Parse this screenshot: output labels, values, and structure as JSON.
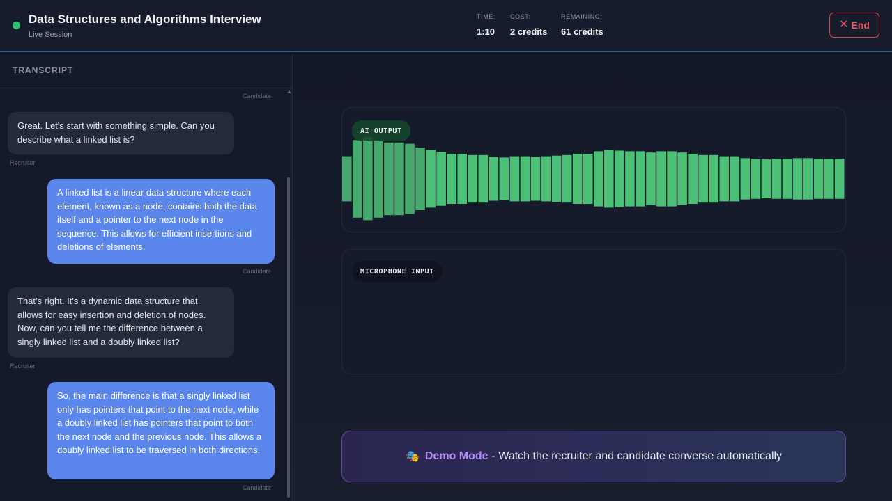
{
  "header": {
    "title": "Data Structures and Algorithms Interview",
    "subtitle": "Live Session",
    "stats": {
      "time_label": "TIME:",
      "time_value": "1:10",
      "cost_label": "COST:",
      "cost_value": "2 credits",
      "remaining_label": "REMAINING:",
      "remaining_value": "61 credits"
    },
    "end_icon": "✕",
    "end_label": "End",
    "live_color": "#2fbf71"
  },
  "transcript": {
    "title": "TRANSCRIPT",
    "top_role": "Candidate",
    "messages": [
      {
        "role": "Recruiter",
        "text": "Great. Let's start with something simple. Can you describe what a linked list is?"
      },
      {
        "role": "Candidate",
        "text": "A linked list is a linear data structure where each element, known as a node, contains both the data itself and a pointer to the next node in the sequence. This allows for efficient insertions and deletions of elements."
      },
      {
        "role": "Recruiter",
        "text": "That's right. It's a dynamic data structure that allows for easy insertion and deletion of nodes. Now, can you tell me the difference between a singly linked list and a doubly linked list?"
      },
      {
        "role": "Candidate",
        "text": "So, the main difference is that a singly linked list only has pointers that point to the next node, while a doubly linked list has pointers that point to both the next node and the previous node. This allows a doubly linked list to be traversed in both directions."
      }
    ]
  },
  "visualizers": {
    "ai_output_label": "AI OUTPUT",
    "mic_input_label": "MICROPHONE INPUT",
    "wave_color": "#4fc97a",
    "wave_levels": [
      0.36,
      0.62,
      0.66,
      0.62,
      0.58,
      0.58,
      0.56,
      0.5,
      0.46,
      0.43,
      0.4,
      0.4,
      0.38,
      0.38,
      0.35,
      0.34,
      0.36,
      0.36,
      0.35,
      0.36,
      0.37,
      0.38,
      0.4,
      0.4,
      0.44,
      0.46,
      0.45,
      0.44,
      0.44,
      0.42,
      0.44,
      0.44,
      0.42,
      0.4,
      0.38,
      0.38,
      0.36,
      0.36,
      0.33,
      0.32,
      0.31,
      0.32,
      0.32,
      0.33,
      0.33,
      0.32,
      0.32,
      0.32
    ]
  },
  "demo": {
    "icon": "🎭",
    "strong": "Demo Mode",
    "text": "- Watch the recruiter and candidate converse automatically",
    "accent": "#b48cf5"
  }
}
